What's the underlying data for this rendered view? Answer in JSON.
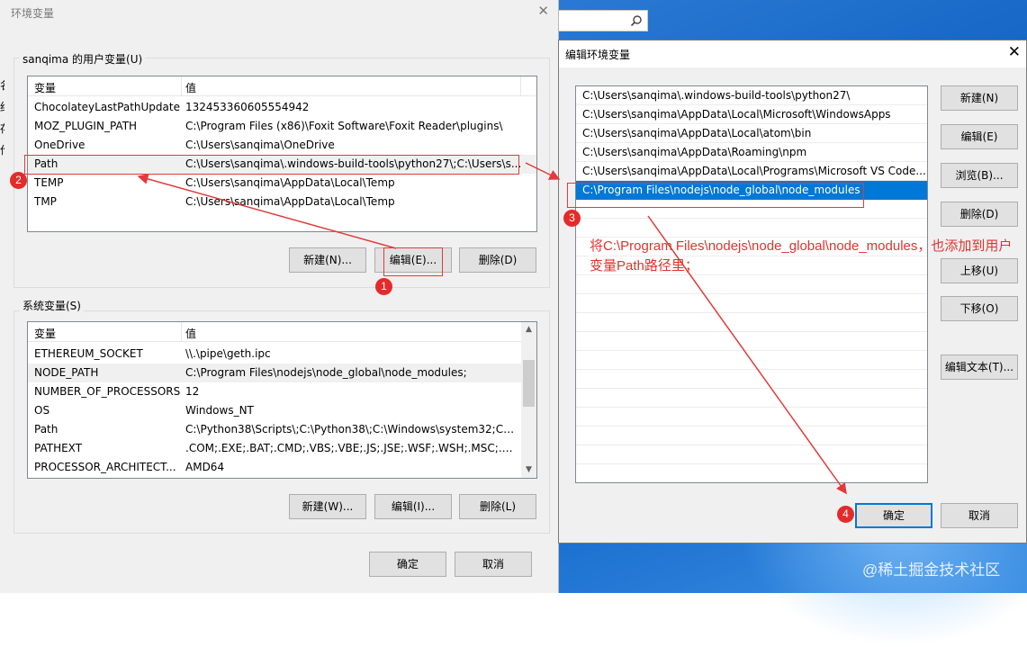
{
  "background": {
    "left_edge_chars": [
      "名",
      "细",
      "存",
      "作"
    ]
  },
  "env_window": {
    "title": "环境变量",
    "user_group_label": "sanqima 的用户变量(U)",
    "system_group_label": "系统变量(S)",
    "col_var": "变量",
    "col_val": "值",
    "user_vars": [
      {
        "name": "ChocolateyLastPathUpdate",
        "value": "132453360605554942"
      },
      {
        "name": "MOZ_PLUGIN_PATH",
        "value": "C:\\Program Files (x86)\\Foxit Software\\Foxit Reader\\plugins\\"
      },
      {
        "name": "OneDrive",
        "value": "C:\\Users\\sanqima\\OneDrive"
      },
      {
        "name": "Path",
        "value": "C:\\Users\\sanqima\\.windows-build-tools\\python27\\;C:\\Users\\s..."
      },
      {
        "name": "TEMP",
        "value": "C:\\Users\\sanqima\\AppData\\Local\\Temp"
      },
      {
        "name": "TMP",
        "value": "C:\\Users\\sanqima\\AppData\\Local\\Temp"
      }
    ],
    "system_vars": [
      {
        "name": "ETHEREUM_SOCKET",
        "value": "\\\\.\\pipe\\geth.ipc"
      },
      {
        "name": "NODE_PATH",
        "value": "C:\\Program Files\\nodejs\\node_global\\node_modules;"
      },
      {
        "name": "NUMBER_OF_PROCESSORS",
        "value": "12"
      },
      {
        "name": "OS",
        "value": "Windows_NT"
      },
      {
        "name": "Path",
        "value": "C:\\Python38\\Scripts\\;C:\\Python38\\;C:\\Windows\\system32;C:\\W..."
      },
      {
        "name": "PATHEXT",
        "value": ".COM;.EXE;.BAT;.CMD;.VBS;.VBE;.JS;.JSE;.WSF;.WSH;.MSC;.PY;.P..."
      },
      {
        "name": "PROCESSOR_ARCHITECT...",
        "value": "AMD64"
      }
    ],
    "user_buttons": {
      "new": "新建(N)...",
      "edit": "编辑(E)...",
      "delete": "删除(D)"
    },
    "system_buttons": {
      "new": "新建(W)...",
      "edit": "编辑(I)...",
      "delete": "删除(L)"
    },
    "ok": "确定",
    "cancel": "取消"
  },
  "edit_window": {
    "title": "编辑环境变量",
    "paths": [
      "C:\\Users\\sanqima\\.windows-build-tools\\python27\\",
      "C:\\Users\\sanqima\\AppData\\Local\\Microsoft\\WindowsApps",
      "C:\\Users\\sanqima\\AppData\\Local\\atom\\bin",
      "C:\\Users\\sanqima\\AppData\\Roaming\\npm",
      "C:\\Users\\sanqima\\AppData\\Local\\Programs\\Microsoft VS Code...",
      "C:\\Program Files\\nodejs\\node_global\\node_modules"
    ],
    "buttons": {
      "new": "新建(N)",
      "edit": "编辑(E)",
      "browse": "浏览(B)...",
      "delete": "删除(D)",
      "move_up": "上移(U)",
      "move_down": "下移(O)",
      "edit_text": "编辑文本(T)..."
    },
    "ok": "确定",
    "cancel": "取消"
  },
  "annotations": {
    "badges": [
      "1",
      "2",
      "3",
      "4"
    ],
    "note": "将C:\\Program Files\\nodejs\\node_global\\node_modules，也添加到用户变量Path路径里；",
    "accent_color": "#e52a2a"
  },
  "watermark": "@稀土掘金技术社区"
}
